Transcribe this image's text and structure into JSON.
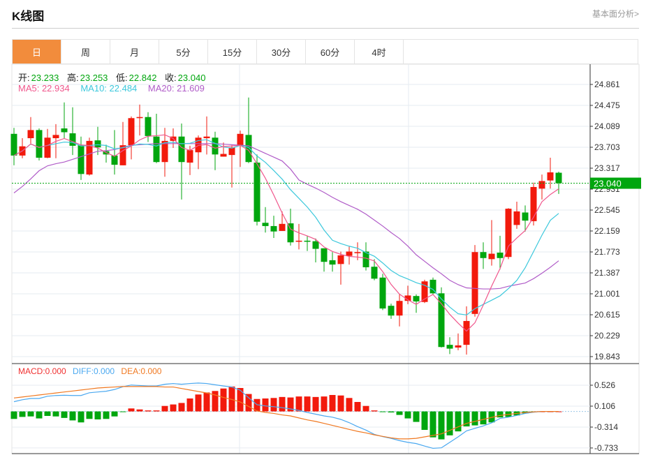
{
  "header": {
    "title": "K线图",
    "link": "基本面分析>"
  },
  "tabs": [
    {
      "label": "日",
      "active": true
    },
    {
      "label": "周"
    },
    {
      "label": "月"
    },
    {
      "label": "5分"
    },
    {
      "label": "15分"
    },
    {
      "label": "30分"
    },
    {
      "label": "60分"
    },
    {
      "label": "4时"
    }
  ],
  "ohlc_legend": {
    "open_label": "开:",
    "open": "23.233",
    "high_label": "高:",
    "high": "23.253",
    "low_label": "低:",
    "low": "22.842",
    "close_label": "收:",
    "close": "23.040"
  },
  "ma_legend": {
    "ma5": "MA5: 22.934",
    "ma10": "MA10: 22.484",
    "ma20": "MA20: 21.609"
  },
  "macd_legend": {
    "macd": "MACD:0.000",
    "diff": "DIFF:0.000",
    "dea": "DEA:0.000"
  },
  "colors": {
    "up": "#f21a0c",
    "down": "#00a60e",
    "ma5": "#f0568c",
    "ma10": "#3cc8dc",
    "ma20": "#b05cc8",
    "diff": "#4aa8f0",
    "dea": "#f07820",
    "accent": "#f28c3c"
  },
  "chart_data": {
    "type": "candlestick",
    "price_axis": {
      "ticks": [
        "24.861",
        "24.475",
        "24.089",
        "23.703",
        "23.317",
        "22.931",
        "22.545",
        "22.159",
        "21.773",
        "21.387",
        "21.001",
        "20.615",
        "20.229",
        "19.843"
      ],
      "range": [
        19.843,
        24.861
      ]
    },
    "last_price": "23.040",
    "candles_ohlc": [
      [
        23.95,
        24.06,
        23.37,
        23.55
      ],
      [
        23.55,
        23.87,
        23.5,
        23.72
      ],
      [
        23.87,
        24.26,
        23.77,
        24.02
      ],
      [
        24.02,
        24.05,
        23.46,
        23.51
      ],
      [
        23.51,
        24.04,
        23.5,
        23.88
      ],
      [
        23.87,
        24.13,
        23.5,
        23.93
      ],
      [
        24.05,
        24.53,
        23.87,
        23.98
      ],
      [
        23.96,
        24.44,
        23.56,
        23.73
      ],
      [
        23.74,
        23.9,
        23.1,
        23.21
      ],
      [
        23.2,
        23.88,
        23.18,
        23.82
      ],
      [
        23.83,
        24.08,
        23.56,
        23.7
      ],
      [
        23.63,
        23.75,
        23.42,
        23.57
      ],
      [
        23.55,
        24.02,
        23.2,
        23.38
      ],
      [
        23.37,
        24.17,
        23.37,
        23.74
      ],
      [
        23.74,
        24.27,
        23.48,
        24.24
      ],
      [
        24.24,
        24.49,
        23.92,
        24.26
      ],
      [
        24.26,
        24.35,
        23.8,
        23.91
      ],
      [
        23.9,
        24.32,
        23.41,
        23.43
      ],
      [
        23.43,
        24.06,
        23.16,
        23.82
      ],
      [
        23.82,
        24.05,
        23.69,
        23.9
      ],
      [
        23.9,
        24.14,
        22.74,
        23.43
      ],
      [
        23.42,
        23.73,
        23.19,
        23.65
      ],
      [
        23.61,
        23.92,
        23.3,
        23.88
      ],
      [
        23.87,
        24.27,
        23.57,
        23.9
      ],
      [
        23.88,
        23.99,
        23.28,
        23.57
      ],
      [
        23.53,
        23.79,
        23.53,
        23.58
      ],
      [
        23.56,
        23.74,
        22.96,
        23.7
      ],
      [
        23.74,
        24.01,
        23.34,
        23.95
      ],
      [
        23.93,
        24.62,
        23.41,
        23.43
      ],
      [
        23.42,
        23.57,
        22.26,
        22.33
      ],
      [
        22.31,
        22.6,
        22.13,
        22.25
      ],
      [
        22.25,
        22.44,
        22.03,
        22.15
      ],
      [
        22.16,
        22.52,
        22.16,
        22.29
      ],
      [
        22.3,
        22.57,
        21.89,
        21.95
      ],
      [
        21.97,
        22.29,
        21.82,
        21.98
      ],
      [
        21.98,
        22.07,
        21.79,
        21.97
      ],
      [
        21.97,
        22.02,
        21.58,
        21.83
      ],
      [
        21.84,
        21.84,
        21.41,
        21.59
      ],
      [
        21.62,
        21.77,
        21.41,
        21.54
      ],
      [
        21.55,
        21.78,
        21.17,
        21.71
      ],
      [
        21.7,
        21.87,
        21.54,
        21.78
      ],
      [
        21.75,
        21.95,
        21.62,
        21.77
      ],
      [
        21.78,
        21.95,
        21.43,
        21.49
      ],
      [
        21.5,
        21.64,
        21.25,
        21.28
      ],
      [
        21.3,
        21.37,
        20.7,
        20.73
      ],
      [
        20.78,
        20.82,
        20.54,
        20.6
      ],
      [
        20.6,
        20.99,
        20.4,
        20.87
      ],
      [
        20.87,
        21.15,
        20.81,
        20.97
      ],
      [
        20.96,
        20.99,
        20.65,
        20.86
      ],
      [
        20.85,
        21.26,
        20.83,
        21.23
      ],
      [
        21.26,
        21.3,
        20.99,
        21.01
      ],
      [
        21.01,
        21.12,
        20.01,
        20.02
      ],
      [
        20.06,
        20.2,
        19.89,
        19.99
      ],
      [
        20.01,
        20.27,
        19.96,
        20.05
      ],
      [
        20.06,
        20.77,
        19.88,
        20.5
      ],
      [
        20.63,
        21.9,
        20.58,
        21.77
      ],
      [
        21.77,
        21.95,
        21.46,
        21.66
      ],
      [
        21.64,
        22.36,
        21.52,
        21.74
      ],
      [
        21.76,
        22.07,
        21.45,
        21.66
      ],
      [
        21.68,
        22.58,
        21.64,
        22.57
      ],
      [
        22.27,
        22.7,
        22.2,
        22.52
      ],
      [
        22.5,
        22.63,
        22.15,
        22.35
      ],
      [
        22.34,
        23.05,
        22.26,
        22.97
      ],
      [
        22.94,
        23.2,
        22.74,
        23.08
      ],
      [
        23.09,
        23.51,
        22.94,
        23.24
      ],
      [
        23.233,
        23.253,
        22.842,
        23.04
      ]
    ],
    "ma20": [
      22.86,
      22.98,
      23.12,
      23.27,
      23.36,
      23.4,
      23.43,
      23.48,
      23.53,
      23.58,
      23.63,
      23.64,
      23.66,
      23.7,
      23.74,
      23.75,
      23.76,
      23.77,
      23.77,
      23.77,
      23.77,
      23.77,
      23.77,
      23.77,
      23.77,
      23.76,
      23.75,
      23.74,
      23.73,
      23.66,
      23.59,
      23.52,
      23.45,
      23.3,
      23.1,
      23.02,
      22.95,
      22.87,
      22.78,
      22.7,
      22.63,
      22.56,
      22.47,
      22.36,
      22.25,
      22.13,
      22.02,
      21.88,
      21.72,
      21.6,
      21.48,
      21.37,
      21.25,
      21.17,
      21.11,
      21.1,
      21.09,
      21.09,
      21.1,
      21.14,
      21.17,
      21.2,
      21.28,
      21.38,
      21.49,
      21.61
    ],
    "macd_axis": {
      "ticks": [
        "0.526",
        "0.106",
        "-0.314",
        "-0.733"
      ]
    },
    "macd": [
      -0.15,
      -0.11,
      -0.1,
      -0.14,
      -0.09,
      -0.1,
      -0.13,
      -0.18,
      -0.22,
      -0.15,
      -0.16,
      -0.15,
      -0.1,
      -0.01,
      0.06,
      0.04,
      0.02,
      0.02,
      0.11,
      0.14,
      0.17,
      0.26,
      0.34,
      0.38,
      0.41,
      0.46,
      0.5,
      0.47,
      0.35,
      0.25,
      0.26,
      0.27,
      0.29,
      0.28,
      0.3,
      0.3,
      0.29,
      0.3,
      0.33,
      0.32,
      0.27,
      0.19,
      0.11,
      0.02,
      -0.01,
      -0.02,
      -0.07,
      -0.14,
      -0.21,
      -0.37,
      -0.52,
      -0.56,
      -0.48,
      -0.4,
      -0.3,
      -0.28,
      -0.26,
      -0.22,
      -0.12,
      -0.11,
      -0.08,
      -0.04,
      -0.01,
      0.0,
      0.0,
      0.0
    ],
    "dea": [
      0.27,
      0.29,
      0.31,
      0.33,
      0.35,
      0.37,
      0.39,
      0.41,
      0.43,
      0.45,
      0.47,
      0.48,
      0.49,
      0.5,
      0.5,
      0.5,
      0.5,
      0.5,
      0.49,
      0.49,
      0.46,
      0.43,
      0.4,
      0.37,
      0.33,
      0.28,
      0.24,
      0.19,
      0.1,
      0.01,
      -0.02,
      -0.04,
      -0.07,
      -0.09,
      -0.13,
      -0.17,
      -0.2,
      -0.24,
      -0.28,
      -0.32,
      -0.36,
      -0.4,
      -0.43,
      -0.47,
      -0.5,
      -0.53,
      -0.55,
      -0.55,
      -0.54,
      -0.51,
      -0.48,
      -0.45,
      -0.38,
      -0.31,
      -0.24,
      -0.2,
      -0.16,
      -0.12,
      -0.08,
      -0.06,
      -0.04,
      -0.02,
      -0.01,
      0.0,
      0.0,
      0.0
    ]
  }
}
